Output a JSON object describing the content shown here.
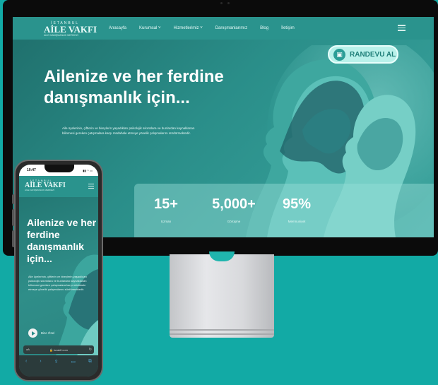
{
  "site": {
    "logo": {
      "line1": "İSTANBUL",
      "line2": "AİLE VAKFI",
      "line3": "AİLE DANIŞMANLIK MERKEZİ"
    },
    "nav": [
      "Anasayfa",
      "Kurumsal ˅",
      "Hizmetlerimiz ˅",
      "Danışmanlarımız",
      "Blog",
      "İletişim"
    ],
    "cta": {
      "label": "RANDEVU AL",
      "icon": "calendar-icon"
    },
    "hero": {
      "title": "Ailenize ve her ferdine danışmanlık için...",
      "text": "Aile üyelerinin, çiftlerin ve bireylerin yaşadıkları psikolojik sıkıntılara ve bunlardan kaynaklanan bilinmesi gereken çatışmalara karşı müdahale etmeye yönelik çalışmalarını sürdürmektedir."
    },
    "stats": [
      {
        "value": "15+",
        "label": "Uzman"
      },
      {
        "value": "5,000+",
        "label": "Görüşme"
      },
      {
        "value": "95%",
        "label": "Memnuniyet"
      }
    ]
  },
  "phone": {
    "time": "10:47",
    "title": "Ailenize ve her ferdine danışmanlık için...",
    "text": "Aile üyelerinin, çiftlerin ve bireylerin yaşadıkları psikolojik sıkıntılara ve bunlardan kaynaklanan bilinmesi gereken çatışmalara karşı müdahale etmeye yönelik çalışmalarını sürdürmektedir.",
    "video_label": "Bize Özel",
    "url": "🔒 isvakfi.com",
    "aa": "aA",
    "reload": "↻",
    "toolbar": [
      "‹",
      "›",
      "⇪",
      "▭",
      "⧉"
    ]
  },
  "colors": {
    "background": "#12aaa5",
    "navbar": "#2a938d",
    "accent": "#b9f1ea"
  }
}
